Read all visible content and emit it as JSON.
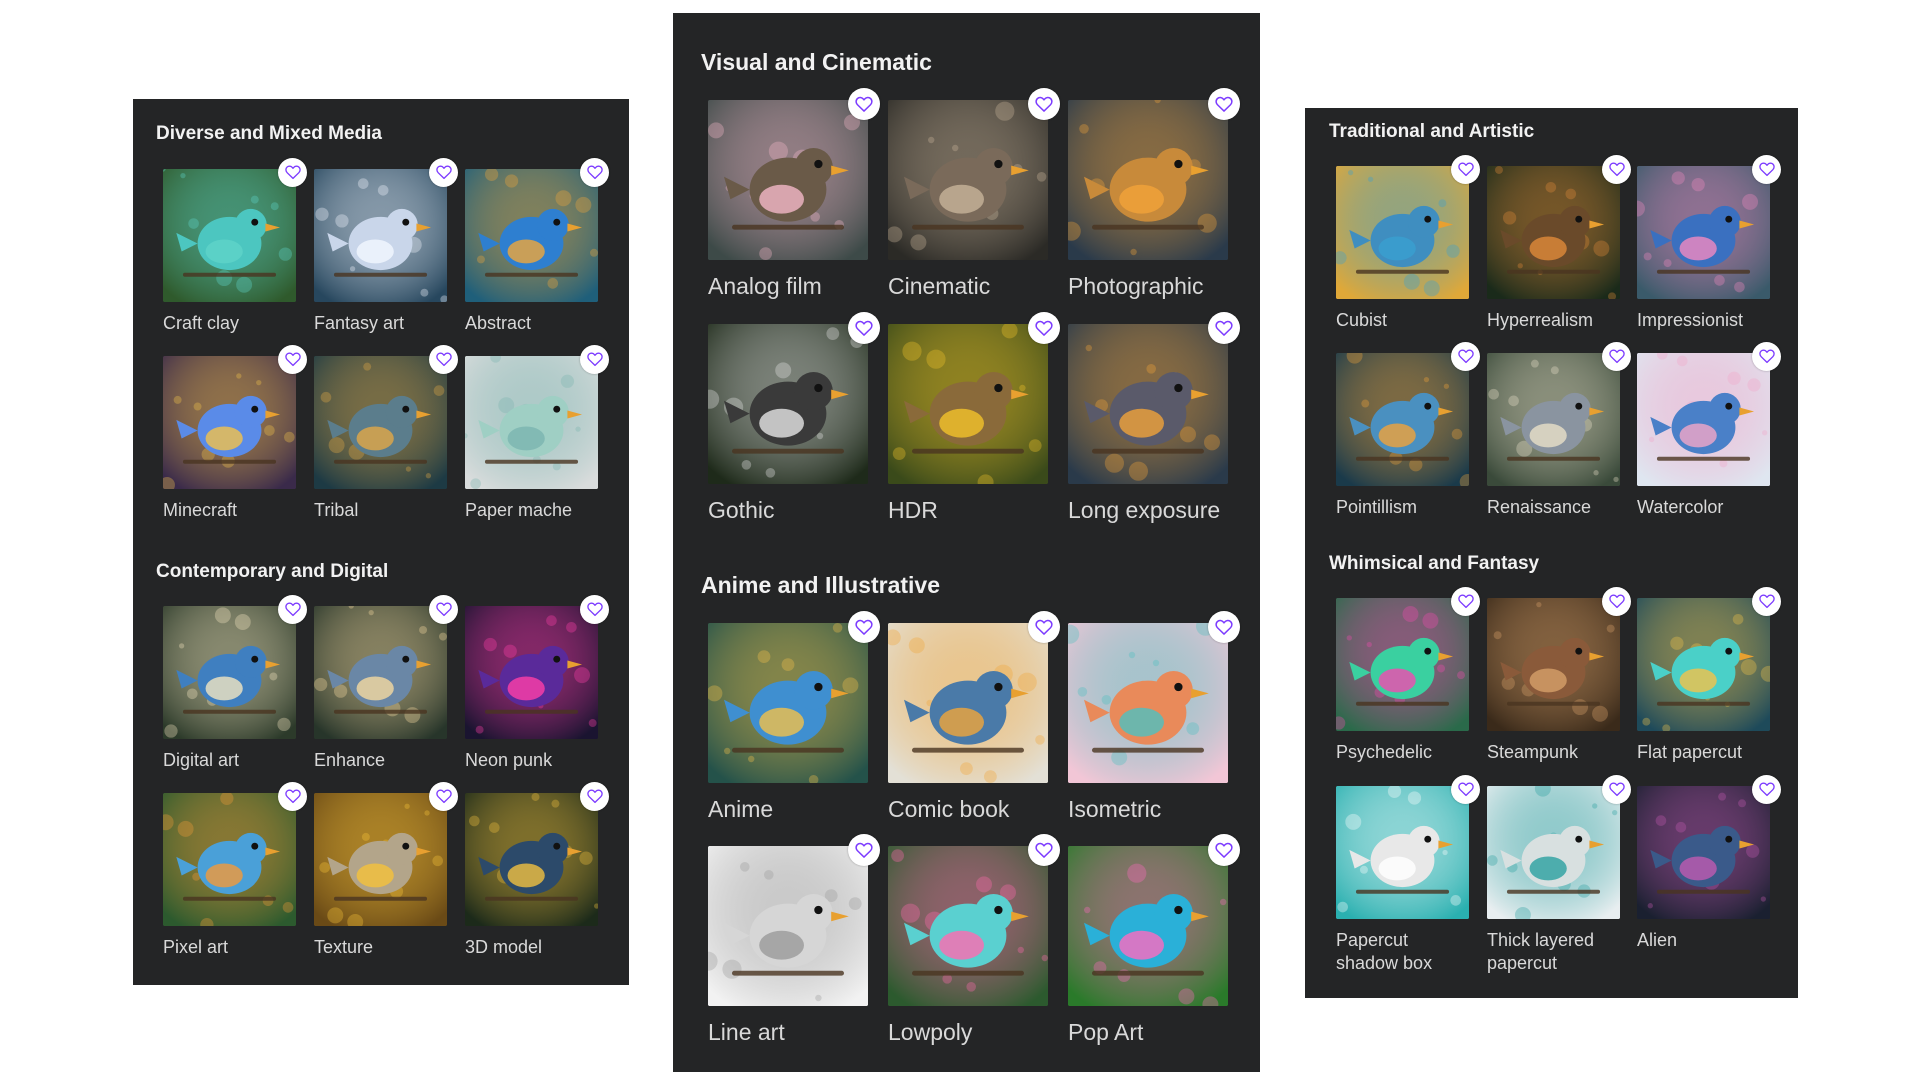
{
  "theme": {
    "panel_bg": "#242526",
    "heart_color": "#7d3cff",
    "label_color": "#d9d9d9",
    "title_color": "#f2f2f2"
  },
  "panels": [
    {
      "id": "left",
      "sections": [
        {
          "title": "Diverse and Mixed Media",
          "items": [
            {
              "label": "Craft clay",
              "bg": "#2f5a2c",
              "accent": "#5fd3c8",
              "bird": "#4cc6c0",
              "icon": "heart-icon"
            },
            {
              "label": "Fantasy art",
              "bg": "#27475e",
              "accent": "#f3f7ff",
              "bird": "#c9d6ea",
              "icon": "heart-icon"
            },
            {
              "label": "Abstract",
              "bg": "#1f5f7a",
              "accent": "#f0a73a",
              "bird": "#2e7fd0",
              "icon": "heart-icon"
            },
            {
              "label": "Minecraft",
              "bg": "#3a2a4a",
              "accent": "#f2c24a",
              "bird": "#5a8be8",
              "icon": "heart-icon"
            },
            {
              "label": "Tribal",
              "bg": "#1d3a44",
              "accent": "#e2a846",
              "bird": "#5b7d8c",
              "icon": "heart-icon"
            },
            {
              "label": "Paper mache",
              "bg": "#d9dcdc",
              "accent": "#7bb4b0",
              "bird": "#9fcfc4",
              "icon": "heart-icon"
            }
          ]
        },
        {
          "title": "Contemporary and Digital",
          "items": [
            {
              "label": "Digital art",
              "bg": "#2c3a2a",
              "accent": "#f3e6c0",
              "bird": "#3f7fc0",
              "icon": "heart-icon"
            },
            {
              "label": "Enhance",
              "bg": "#27352a",
              "accent": "#f5d9a0",
              "bird": "#6a87a6",
              "icon": "heart-icon"
            },
            {
              "label": "Neon punk",
              "bg": "#1a1430",
              "accent": "#ff3fa8",
              "bird": "#5a2a9a",
              "icon": "heart-icon"
            },
            {
              "label": "Pixel art",
              "bg": "#2c5a2e",
              "accent": "#f29a3a",
              "bird": "#4aa0d8",
              "icon": "heart-icon"
            },
            {
              "label": "Texture",
              "bg": "#6a4a16",
              "accent": "#f5c23a",
              "bird": "#b3a58a",
              "icon": "heart-icon"
            },
            {
              "label": "3D model",
              "bg": "#1c2a1a",
              "accent": "#f2c040",
              "bird": "#2c4a6a",
              "icon": "heart-icon"
            }
          ]
        }
      ]
    },
    {
      "id": "middle",
      "sections": [
        {
          "title": "Visual and Cinematic",
          "items": [
            {
              "label": "Analog film",
              "bg": "#3d4a48",
              "accent": "#f4b8c8",
              "bird": "#6a5a48",
              "icon": "heart-icon"
            },
            {
              "label": "Cinematic",
              "bg": "#2b2a26",
              "accent": "#c8b49a",
              "bird": "#7a6a5a",
              "icon": "heart-icon"
            },
            {
              "label": "Photographic",
              "bg": "#2a3a4a",
              "accent": "#f2a33a",
              "bird": "#c88a3a",
              "icon": "heart-icon"
            },
            {
              "label": "Gothic",
              "bg": "#1e2a1a",
              "accent": "#e6e6e6",
              "bird": "#3a3a3a",
              "icon": "heart-icon"
            },
            {
              "label": "HDR",
              "bg": "#3a4a1a",
              "accent": "#f2c32a",
              "bird": "#8a6a3a",
              "icon": "heart-icon"
            },
            {
              "label": "Long exposure",
              "bg": "#2a3a4a",
              "accent": "#f0a23a",
              "bird": "#5a5a6a",
              "icon": "heart-icon"
            }
          ]
        },
        {
          "title": "Anime and Illustrative",
          "items": [
            {
              "label": "Anime",
              "bg": "#24524a",
              "accent": "#f3c04a",
              "bird": "#3f8fd0",
              "icon": "heart-icon"
            },
            {
              "label": "Comic book",
              "bg": "#e3e0d6",
              "accent": "#f0a63a",
              "bird": "#4a7aa8",
              "icon": "heart-icon"
            },
            {
              "label": "Isometric",
              "bg": "#f2c6d6",
              "accent": "#4ec0c0",
              "bird": "#e98a5a",
              "icon": "heart-icon"
            },
            {
              "label": "Line art",
              "bg": "#f2f2f2",
              "accent": "#9a9a9a",
              "bird": "#d6d6d6",
              "icon": "heart-icon"
            },
            {
              "label": "Lowpoly",
              "bg": "#2c5a2e",
              "accent": "#ff6ab0",
              "bird": "#5ad0d0",
              "icon": "heart-icon"
            },
            {
              "label": "Pop Art",
              "bg": "#2a7a2a",
              "accent": "#ff6ac0",
              "bird": "#2ab0d8",
              "icon": "heart-icon"
            }
          ]
        }
      ]
    },
    {
      "id": "right",
      "sections": [
        {
          "title": "Traditional and Artistic",
          "items": [
            {
              "label": "Cubist",
              "bg": "#e0a838",
              "accent": "#3aa0d0",
              "bird": "#3f8ec0",
              "icon": "heart-icon"
            },
            {
              "label": "Hyperrealism",
              "bg": "#1a2a1a",
              "accent": "#e08a3a",
              "bird": "#6a4a2a",
              "icon": "heart-icon"
            },
            {
              "label": "Impressionist",
              "bg": "#3a5a6a",
              "accent": "#f28ac0",
              "bird": "#3a70c0",
              "icon": "heart-icon"
            },
            {
              "label": "Pointillism",
              "bg": "#1a3a4a",
              "accent": "#f0a23a",
              "bird": "#4a90c0",
              "icon": "heart-icon"
            },
            {
              "label": "Renaissance",
              "bg": "#3a4a3a",
              "accent": "#e8e0c8",
              "bird": "#8a94a0",
              "icon": "heart-icon"
            },
            {
              "label": "Watercolor",
              "bg": "#dfe6f0",
              "accent": "#f2a6c8",
              "bird": "#4a80c8",
              "icon": "heart-icon"
            }
          ]
        },
        {
          "title": "Whimsical and Fantasy",
          "items": [
            {
              "label": "Psychedelic",
              "bg": "#2a6a4a",
              "accent": "#f24ab0",
              "bird": "#3ad0a0",
              "icon": "heart-icon"
            },
            {
              "label": "Steampunk",
              "bg": "#3a2a1a",
              "accent": "#d6a06a",
              "bird": "#8a5a3a",
              "icon": "heart-icon"
            },
            {
              "label": "Flat papercut",
              "bg": "#1e4a5a",
              "accent": "#f2c24a",
              "bird": "#4ad0c8",
              "icon": "heart-icon"
            },
            {
              "label": "Papercut\nshadow box",
              "bg": "#2ab0b0",
              "accent": "#ffffff",
              "bird": "#e8e8e8",
              "icon": "heart-icon"
            },
            {
              "label": "Thick layered\npapercut",
              "bg": "#e8eef0",
              "accent": "#2aa0a0",
              "bird": "#d8e0e0",
              "icon": "heart-icon"
            },
            {
              "label": "Alien",
              "bg": "#1a2030",
              "accent": "#c05ab0",
              "bird": "#3a5a8a",
              "icon": "heart-icon"
            }
          ]
        }
      ]
    }
  ]
}
